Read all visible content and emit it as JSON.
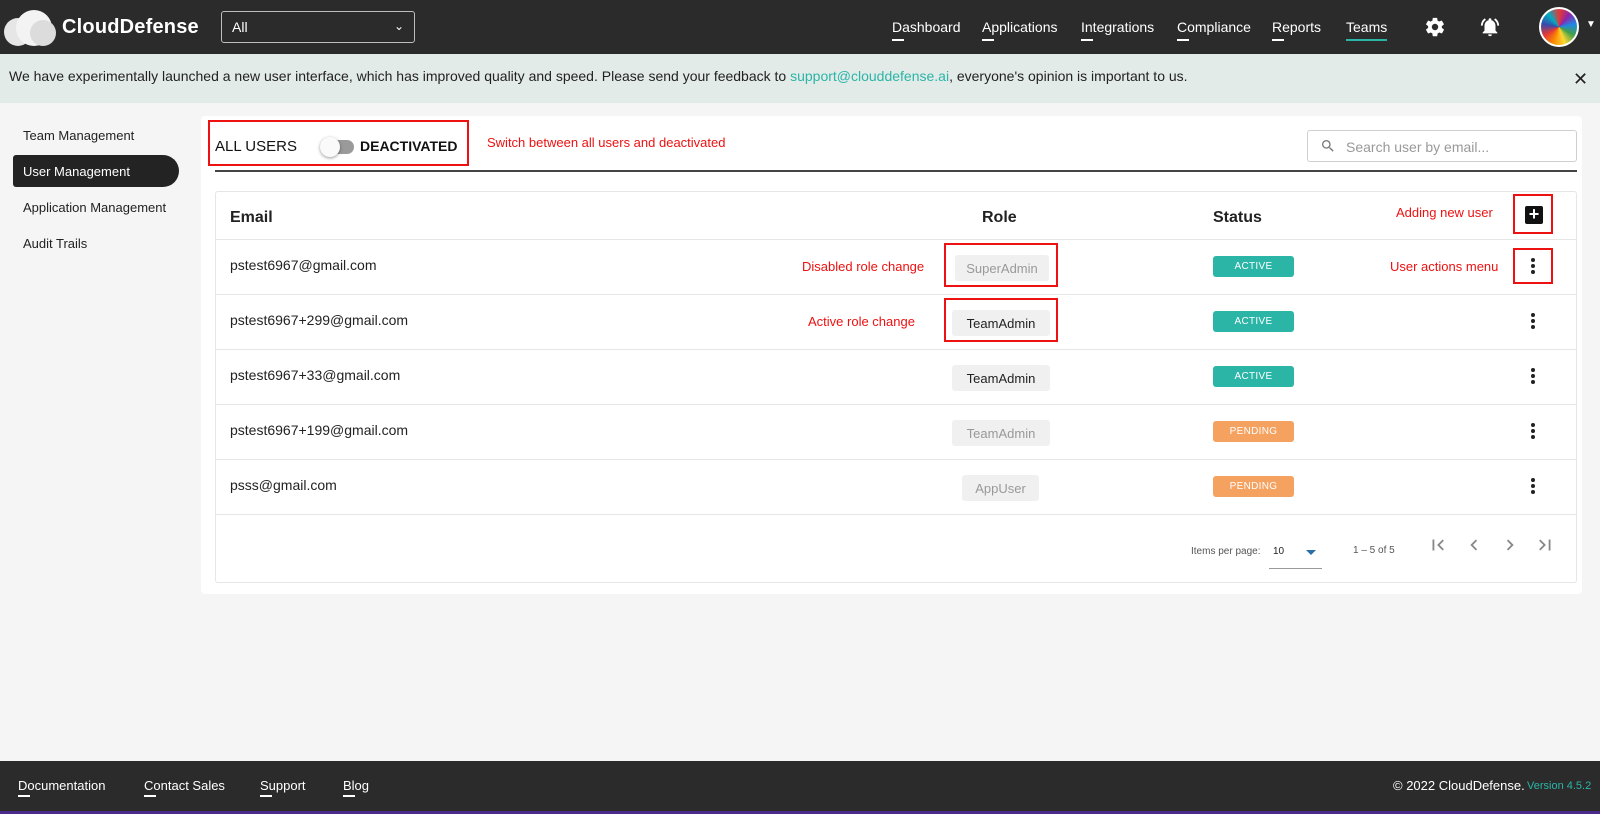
{
  "brand": {
    "name": "CloudDefense"
  },
  "top_select": {
    "value": "All"
  },
  "nav": {
    "items": [
      {
        "label": "Dashboard",
        "active": false
      },
      {
        "label": "Applications",
        "active": false
      },
      {
        "label": "Integrations",
        "active": false
      },
      {
        "label": "Compliance",
        "active": false
      },
      {
        "label": "Reports",
        "active": false
      },
      {
        "label": "Teams",
        "active": true
      }
    ]
  },
  "banner": {
    "text_before": "We have experimentally launched a new user interface, which has improved quality and speed. Please send your feedback to ",
    "link": "support@clouddefense.ai",
    "text_after": ", everyone's opinion is important to us.",
    "close": "✕"
  },
  "sidebar": {
    "items": [
      {
        "label": "Team Management",
        "active": false
      },
      {
        "label": "User Management",
        "active": true
      },
      {
        "label": "Application Management",
        "active": false
      },
      {
        "label": "Audit Trails",
        "active": false
      }
    ]
  },
  "filter": {
    "all_label": "ALL USERS",
    "deactivated_label": "DEACTIVATED",
    "toggle_on": false
  },
  "search": {
    "placeholder": "Search user by email..."
  },
  "annotations": {
    "switch": "Switch between all users and deactivated",
    "add_user": "Adding new user",
    "actions_menu": "User actions menu",
    "disabled_role": "Disabled role change",
    "active_role": "Active  role change"
  },
  "table": {
    "columns": {
      "email": "Email",
      "role": "Role",
      "status": "Status"
    },
    "rows": [
      {
        "email": "pstest6967@gmail.com",
        "role": "SuperAdmin",
        "role_enabled": false,
        "status": "ACTIVE"
      },
      {
        "email": "pstest6967+299@gmail.com",
        "role": "TeamAdmin",
        "role_enabled": true,
        "status": "ACTIVE"
      },
      {
        "email": "pstest6967+33@gmail.com",
        "role": "TeamAdmin",
        "role_enabled": true,
        "status": "ACTIVE"
      },
      {
        "email": "pstest6967+199@gmail.com",
        "role": "TeamAdmin",
        "role_enabled": false,
        "status": "PENDING"
      },
      {
        "email": "psss@gmail.com",
        "role": "AppUser",
        "role_enabled": false,
        "status": "PENDING"
      }
    ]
  },
  "paginator": {
    "items_label": "Items per page:",
    "page_size": "10",
    "range": "1 – 5 of 5"
  },
  "footer": {
    "links": [
      "Documentation",
      "Contact Sales",
      "Support",
      "Blog"
    ],
    "copyright": "© 2022 CloudDefense.",
    "version": "Version 4.5.2"
  },
  "colors": {
    "accent": "#2bb5a6",
    "active_status": "#2bb5a6",
    "pending_status": "#f5a15f",
    "annotation": "#ee1111",
    "header_bg": "#2b2b2b"
  }
}
